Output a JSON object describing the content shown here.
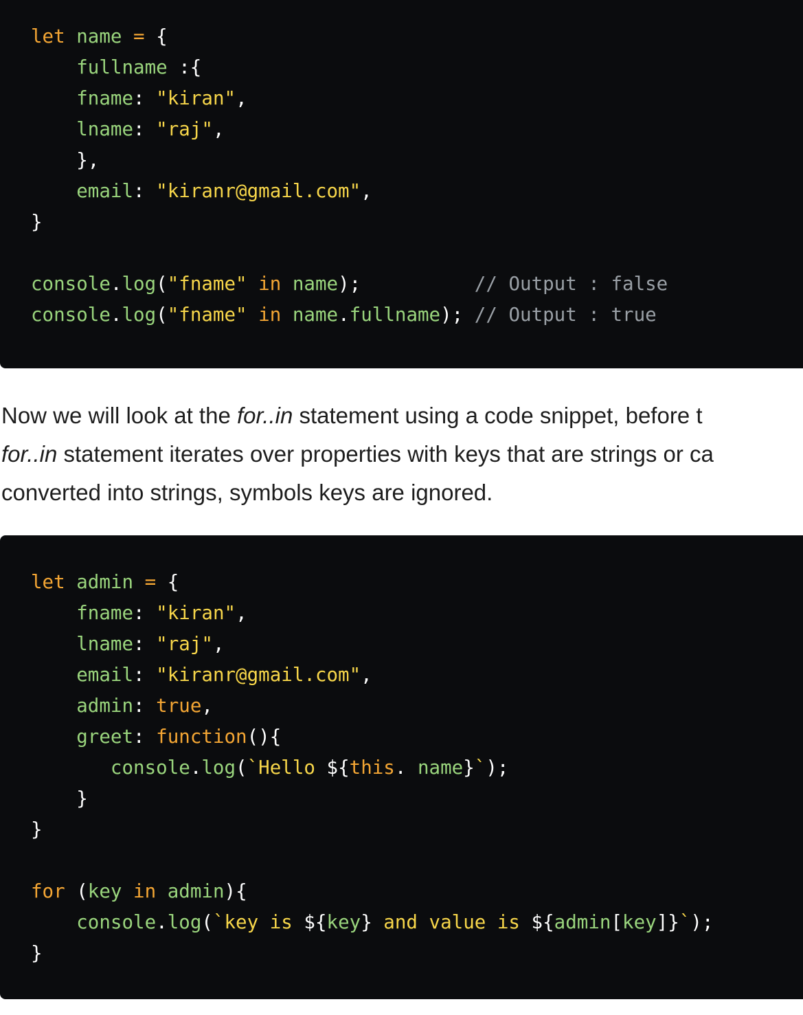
{
  "code_block_1": {
    "lines": [
      [
        {
          "t": "let",
          "c": "kw"
        },
        {
          "t": " ",
          "c": "pun"
        },
        {
          "t": "name",
          "c": "id"
        },
        {
          "t": " ",
          "c": "pun"
        },
        {
          "t": "=",
          "c": "op"
        },
        {
          "t": " {",
          "c": "pun"
        }
      ],
      [
        {
          "t": "    ",
          "c": "pun"
        },
        {
          "t": "fullname",
          "c": "id"
        },
        {
          "t": " :{",
          "c": "pun"
        }
      ],
      [
        {
          "t": "    ",
          "c": "pun"
        },
        {
          "t": "fname",
          "c": "id"
        },
        {
          "t": ": ",
          "c": "pun"
        },
        {
          "t": "\"kiran\"",
          "c": "str"
        },
        {
          "t": ",",
          "c": "pun"
        }
      ],
      [
        {
          "t": "    ",
          "c": "pun"
        },
        {
          "t": "lname",
          "c": "id"
        },
        {
          "t": ": ",
          "c": "pun"
        },
        {
          "t": "\"raj\"",
          "c": "str"
        },
        {
          "t": ",",
          "c": "pun"
        }
      ],
      [
        {
          "t": "    },",
          "c": "pun"
        }
      ],
      [
        {
          "t": "    ",
          "c": "pun"
        },
        {
          "t": "email",
          "c": "id"
        },
        {
          "t": ": ",
          "c": "pun"
        },
        {
          "t": "\"kiranr@gmail.com\"",
          "c": "str"
        },
        {
          "t": ",",
          "c": "pun"
        }
      ],
      [
        {
          "t": "}",
          "c": "pun"
        }
      ],
      [
        {
          "t": "",
          "c": "pun"
        }
      ],
      [
        {
          "t": "console",
          "c": "id"
        },
        {
          "t": ".",
          "c": "pun"
        },
        {
          "t": "log",
          "c": "id"
        },
        {
          "t": "(",
          "c": "pun"
        },
        {
          "t": "\"fname\"",
          "c": "str"
        },
        {
          "t": " ",
          "c": "pun"
        },
        {
          "t": "in",
          "c": "kw"
        },
        {
          "t": " ",
          "c": "pun"
        },
        {
          "t": "name",
          "c": "id"
        },
        {
          "t": ");          ",
          "c": "pun"
        },
        {
          "t": "// Output : false",
          "c": "com"
        }
      ],
      [
        {
          "t": "console",
          "c": "id"
        },
        {
          "t": ".",
          "c": "pun"
        },
        {
          "t": "log",
          "c": "id"
        },
        {
          "t": "(",
          "c": "pun"
        },
        {
          "t": "\"fname\"",
          "c": "str"
        },
        {
          "t": " ",
          "c": "pun"
        },
        {
          "t": "in",
          "c": "kw"
        },
        {
          "t": " ",
          "c": "pun"
        },
        {
          "t": "name",
          "c": "id"
        },
        {
          "t": ".",
          "c": "pun"
        },
        {
          "t": "fullname",
          "c": "id"
        },
        {
          "t": "); ",
          "c": "pun"
        },
        {
          "t": "// Output : true",
          "c": "com"
        }
      ]
    ]
  },
  "paragraph": {
    "lines": [
      [
        {
          "t": "Now we will look at the ",
          "i": false
        },
        {
          "t": "for..in",
          "i": true
        },
        {
          "t": " statement using a code snippet, before t",
          "i": false
        }
      ],
      [
        {
          "t": "for..in",
          "i": true
        },
        {
          "t": " statement iterates over properties with keys that are strings or ca",
          "i": false
        }
      ],
      [
        {
          "t": "converted into strings, symbols keys are ignored.",
          "i": false
        }
      ]
    ]
  },
  "code_block_2": {
    "lines": [
      [
        {
          "t": "let",
          "c": "kw"
        },
        {
          "t": " ",
          "c": "pun"
        },
        {
          "t": "admin",
          "c": "id"
        },
        {
          "t": " ",
          "c": "pun"
        },
        {
          "t": "=",
          "c": "op"
        },
        {
          "t": " {",
          "c": "pun"
        }
      ],
      [
        {
          "t": "    ",
          "c": "pun"
        },
        {
          "t": "fname",
          "c": "id"
        },
        {
          "t": ": ",
          "c": "pun"
        },
        {
          "t": "\"kiran\"",
          "c": "str"
        },
        {
          "t": ",",
          "c": "pun"
        }
      ],
      [
        {
          "t": "    ",
          "c": "pun"
        },
        {
          "t": "lname",
          "c": "id"
        },
        {
          "t": ": ",
          "c": "pun"
        },
        {
          "t": "\"raj\"",
          "c": "str"
        },
        {
          "t": ",",
          "c": "pun"
        }
      ],
      [
        {
          "t": "    ",
          "c": "pun"
        },
        {
          "t": "email",
          "c": "id"
        },
        {
          "t": ": ",
          "c": "pun"
        },
        {
          "t": "\"kiranr@gmail.com\"",
          "c": "str"
        },
        {
          "t": ",",
          "c": "pun"
        }
      ],
      [
        {
          "t": "    ",
          "c": "pun"
        },
        {
          "t": "admin",
          "c": "id"
        },
        {
          "t": ": ",
          "c": "pun"
        },
        {
          "t": "true",
          "c": "bool"
        },
        {
          "t": ",",
          "c": "pun"
        }
      ],
      [
        {
          "t": "    ",
          "c": "pun"
        },
        {
          "t": "greet",
          "c": "id"
        },
        {
          "t": ": ",
          "c": "pun"
        },
        {
          "t": "function",
          "c": "kw"
        },
        {
          "t": "(){",
          "c": "pun"
        }
      ],
      [
        {
          "t": "       ",
          "c": "pun"
        },
        {
          "t": "console",
          "c": "id"
        },
        {
          "t": ".",
          "c": "pun"
        },
        {
          "t": "log",
          "c": "id"
        },
        {
          "t": "(",
          "c": "pun"
        },
        {
          "t": "`Hello ",
          "c": "str"
        },
        {
          "t": "${",
          "c": "pun"
        },
        {
          "t": "this",
          "c": "kw"
        },
        {
          "t": ". ",
          "c": "pun"
        },
        {
          "t": "name",
          "c": "id"
        },
        {
          "t": "}",
          "c": "pun"
        },
        {
          "t": "`",
          "c": "str"
        },
        {
          "t": ");",
          "c": "pun"
        }
      ],
      [
        {
          "t": "    }",
          "c": "pun"
        }
      ],
      [
        {
          "t": "}",
          "c": "pun"
        }
      ],
      [
        {
          "t": "",
          "c": "pun"
        }
      ],
      [
        {
          "t": "for",
          "c": "kw"
        },
        {
          "t": " (",
          "c": "pun"
        },
        {
          "t": "key",
          "c": "id"
        },
        {
          "t": " ",
          "c": "pun"
        },
        {
          "t": "in",
          "c": "kw"
        },
        {
          "t": " ",
          "c": "pun"
        },
        {
          "t": "admin",
          "c": "id"
        },
        {
          "t": "){",
          "c": "pun"
        }
      ],
      [
        {
          "t": "    ",
          "c": "pun"
        },
        {
          "t": "console",
          "c": "id"
        },
        {
          "t": ".",
          "c": "pun"
        },
        {
          "t": "log",
          "c": "id"
        },
        {
          "t": "(",
          "c": "pun"
        },
        {
          "t": "`key is ",
          "c": "str"
        },
        {
          "t": "${",
          "c": "pun"
        },
        {
          "t": "key",
          "c": "id"
        },
        {
          "t": "}",
          "c": "pun"
        },
        {
          "t": " and value is ",
          "c": "str"
        },
        {
          "t": "${",
          "c": "pun"
        },
        {
          "t": "admin",
          "c": "id"
        },
        {
          "t": "[",
          "c": "pun"
        },
        {
          "t": "key",
          "c": "id"
        },
        {
          "t": "]}",
          "c": "pun"
        },
        {
          "t": "`",
          "c": "str"
        },
        {
          "t": ");",
          "c": "pun"
        }
      ],
      [
        {
          "t": "}",
          "c": "pun"
        }
      ]
    ]
  }
}
